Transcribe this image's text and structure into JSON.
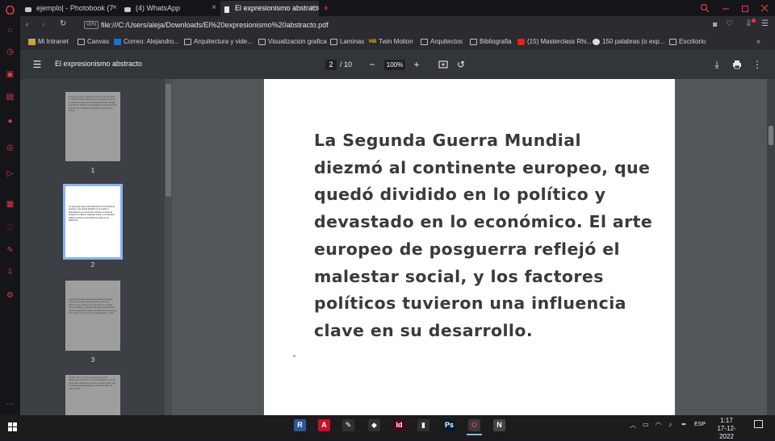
{
  "tabs": [
    {
      "label": "ejemplo| - Photobook (7",
      "active": false
    },
    {
      "label": "(4) WhatsApp",
      "active": false
    },
    {
      "label": "El expresionismo abstracto",
      "active": true
    }
  ],
  "address": {
    "vpn_label": "VPN",
    "url": "file:///C:/Users/aleja/Downloads/El%20expresionismo%20abstracto.pdf"
  },
  "bookmarks": [
    {
      "label": "Mi Intranet",
      "icon": "intranet-icon"
    },
    {
      "label": "Canvas",
      "icon": "folder-icon"
    },
    {
      "label": "Correo: Alejandro...",
      "icon": "outlook-icon"
    },
    {
      "label": "Arquitectura y vide...",
      "icon": "folder-icon"
    },
    {
      "label": "Visualizacion grafica",
      "icon": "folder-icon"
    },
    {
      "label": "Laminas",
      "icon": "folder-icon"
    },
    {
      "label": "Twin Motion",
      "icon": "mb-icon"
    },
    {
      "label": "Arquitectos",
      "icon": "folder-icon"
    },
    {
      "label": "Bibliografia",
      "icon": "folder-icon"
    },
    {
      "label": "(15) Masterclass Rhi...",
      "icon": "youtube-icon"
    },
    {
      "label": "150 palabras (o exp...",
      "icon": "globe-icon"
    },
    {
      "label": "Escritorio",
      "icon": "folder-icon"
    }
  ],
  "pdf": {
    "title": "El expresionismo abstracto",
    "current_page": "2",
    "total_pages": "/ 10",
    "zoom": "100%"
  },
  "thumbnails": [
    {
      "number": "1",
      "text": "El expresionismo abstracto surgió en las décadas de 1940 y 1950 en Nueva York. Aunque diverso en lo estilístico, todos sus practicantes solían trabajar con lienzos grandes, expresaban una potente carga emocional y valoraban el aspecto sensual de la pintura."
    },
    {
      "number": "2",
      "text": "La Segunda Guerra Mundial diezmó al continente europeo, que quedó dividido en lo político y devastado en lo económico. El arte europeo de posguerra reflejó el malestar social, y los factores políticos tuvieron una influencia clave en su desarrollo."
    },
    {
      "number": "3",
      "text": "Los expresionistas abstractos estadounidenses derivan una segunda generación de artistas diversos que centraron su atención en un estilo menos intuitivo y gestual. Sus obras, llamadas de formato gigantesco, llegan a la abstracción total y la concepción por la noción de composición y color."
    },
    {
      "number": "",
      "text": "Donald Judd, uno de sus exponentes más destacados, describió el arte minimalista como «el primer arte abstracto en serio», situado sobre todo en artistas estadounidenses de las décadas de 1960 y 1970."
    }
  ],
  "page_text": "La Segunda Guerra Mundial diezmó al continente europeo, que quedó dividido en lo político y devastado en lo económico. El arte europeo de posguerra reflejó el malestar social, y los factores políticos tuvieron una influencia clave en su desarrollo.",
  "taskbar": {
    "apps": [
      {
        "letter": "R",
        "color": "#2b5797",
        "icon": "revit-icon"
      },
      {
        "letter": "A",
        "color": "#c8102e",
        "icon": "autocad-icon"
      },
      {
        "letter": "✎",
        "color": "#303030",
        "icon": "pencil-app-icon"
      },
      {
        "letter": "◆",
        "color": "#303030",
        "icon": "sketchup-icon"
      },
      {
        "letter": "Id",
        "color": "#49021f",
        "icon": "indesign-icon"
      },
      {
        "letter": "▮",
        "color": "#303030",
        "icon": "archive-app-icon"
      },
      {
        "letter": "Ps",
        "color": "#001e36",
        "icon": "photoshop-icon"
      },
      {
        "letter": "O",
        "color": "#3a3a3a",
        "icon": "opera-icon"
      },
      {
        "letter": "N",
        "color": "#444444",
        "icon": "notion-icon"
      }
    ],
    "language": "ESP",
    "time": "1:17",
    "date": "17-12-2022"
  }
}
